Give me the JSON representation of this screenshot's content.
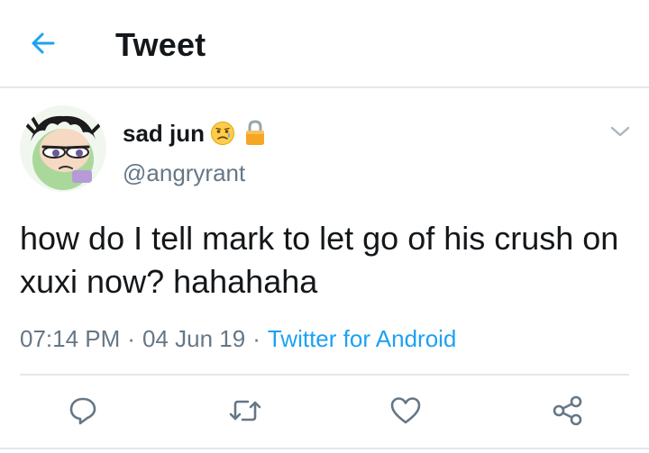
{
  "header": {
    "title": "Tweet",
    "back_icon": "arrow-left-icon"
  },
  "tweet": {
    "author": {
      "display_name": "sad jun",
      "handle": "@angryrant",
      "emoji_badge": "😥",
      "protected_icon": "lock-icon"
    },
    "text": "how do I tell mark to let go of his crush on xuxi now? hahahaha",
    "time": "07:14 PM",
    "date": "04 Jun 19",
    "source": "Twitter for Android",
    "separator": "·"
  },
  "actions": {
    "reply_icon": "reply-icon",
    "retweet_icon": "retweet-icon",
    "like_icon": "heart-icon",
    "share_icon": "share-icon"
  },
  "colors": {
    "accent": "#1da1f2",
    "secondary_text": "#657786",
    "primary_text": "#14171a",
    "divider": "#e1e8ed"
  }
}
